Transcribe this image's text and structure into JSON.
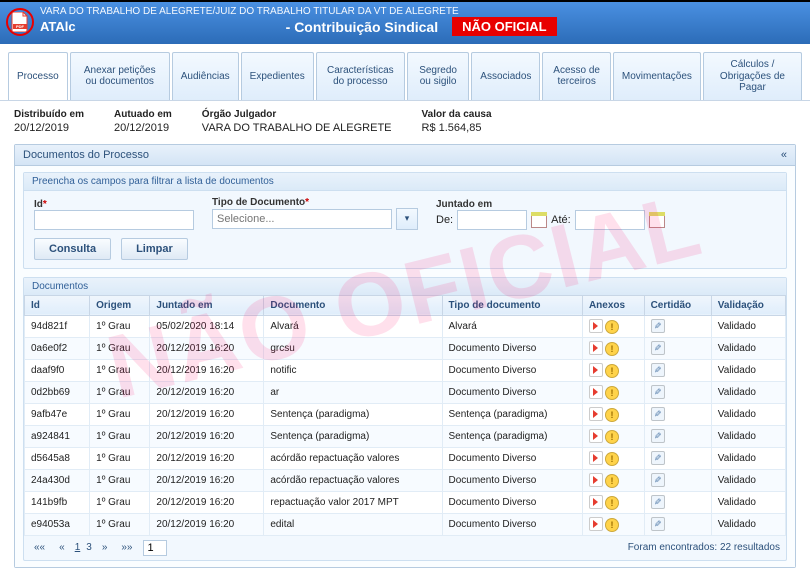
{
  "watermark": "NÃO OFICIAL",
  "header": {
    "line1": "VARA DO TRABALHO DE ALEGRETE/JUIZ DO TRABALHO TITULAR DA VT DE ALEGRETE",
    "atalc": "ATAlc",
    "contrib": "- Contribuição Sindical",
    "badge": "NÃO OFICIAL"
  },
  "tabs": [
    "Processo",
    "Anexar petições ou documentos",
    "Audiências",
    "Expedientes",
    "Características do processo",
    "Segredo ou sigilo",
    "Associados",
    "Acesso de terceiros",
    "Movimentações",
    "Cálculos / Obrigações de Pagar"
  ],
  "meta": {
    "distribuido_lbl": "Distribuído em",
    "distribuido_val": "20/12/2019",
    "autuado_lbl": "Autuado em",
    "autuado_val": "20/12/2019",
    "orgao_lbl": "Órgão Julgador",
    "orgao_val": "VARA DO TRABALHO DE ALEGRETE",
    "valor_lbl": "Valor da causa",
    "valor_val": "R$ 1.564,85"
  },
  "docs_panel": "Documentos do Processo",
  "filter": {
    "title": "Preencha os campos para filtrar a lista de documentos",
    "id_lbl": "Id",
    "tipo_lbl": "Tipo de Documento",
    "tipo_ph": "Selecione...",
    "juntado_lbl": "Juntado em",
    "de_lbl": "De:",
    "ate_lbl": "Até:",
    "consulta": "Consulta",
    "limpar": "Limpar"
  },
  "table": {
    "title": "Documentos",
    "headers": [
      "Id",
      "Origem",
      "Juntado em",
      "Documento",
      "Tipo de documento",
      "Anexos",
      "Certidão",
      "Validação"
    ],
    "rows": [
      {
        "id": "94d821f",
        "origem": "1º Grau",
        "juntado": "05/02/2020 18:14",
        "documento": "Alvará",
        "tipo": "Alvará",
        "anexos": "pw",
        "cert": true,
        "valid": "Validado"
      },
      {
        "id": "0a6e0f2",
        "origem": "1º Grau",
        "juntado": "20/12/2019 16:20",
        "documento": "grcsu",
        "tipo": "Documento Diverso",
        "anexos": "pw",
        "cert": true,
        "valid": "Validado"
      },
      {
        "id": "daaf9f0",
        "origem": "1º Grau",
        "juntado": "20/12/2019 16:20",
        "documento": "notific",
        "tipo": "Documento Diverso",
        "anexos": "pw",
        "cert": true,
        "valid": "Validado"
      },
      {
        "id": "0d2bb69",
        "origem": "1º Grau",
        "juntado": "20/12/2019 16:20",
        "documento": "ar",
        "tipo": "Documento Diverso",
        "anexos": "pw",
        "cert": true,
        "valid": "Validado"
      },
      {
        "id": "9afb47e",
        "origem": "1º Grau",
        "juntado": "20/12/2019 16:20",
        "documento": "Sentença (paradigma)",
        "tipo": "Sentença (paradigma)",
        "anexos": "pw",
        "cert": true,
        "valid": "Validado"
      },
      {
        "id": "a924841",
        "origem": "1º Grau",
        "juntado": "20/12/2019 16:20",
        "documento": "Sentença (paradigma)",
        "tipo": "Sentença (paradigma)",
        "anexos": "pw",
        "cert": true,
        "valid": "Validado"
      },
      {
        "id": "d5645a8",
        "origem": "1º Grau",
        "juntado": "20/12/2019 16:20",
        "documento": "acórdão repactuação valores",
        "tipo": "Documento Diverso",
        "anexos": "pw",
        "cert": true,
        "valid": "Validado"
      },
      {
        "id": "24a430d",
        "origem": "1º Grau",
        "juntado": "20/12/2019 16:20",
        "documento": "acórdão repactuação valores",
        "tipo": "Documento Diverso",
        "anexos": "pw",
        "cert": true,
        "valid": "Validado"
      },
      {
        "id": "141b9fb",
        "origem": "1º Grau",
        "juntado": "20/12/2019 16:20",
        "documento": "repactuação valor 2017 MPT",
        "tipo": "Documento Diverso",
        "anexos": "pw",
        "cert": true,
        "valid": "Validado"
      },
      {
        "id": "e94053a",
        "origem": "1º Grau",
        "juntado": "20/12/2019 16:20",
        "documento": "edital",
        "tipo": "Documento Diverso",
        "anexos": "pw",
        "cert": true,
        "valid": "Validado"
      }
    ],
    "pager": {
      "first": "««",
      "prev": "«",
      "page": "1",
      "sep": "3",
      "next": "»",
      "last": "»»",
      "goto": "1",
      "results": "Foram encontrados: 22 resultados"
    }
  }
}
